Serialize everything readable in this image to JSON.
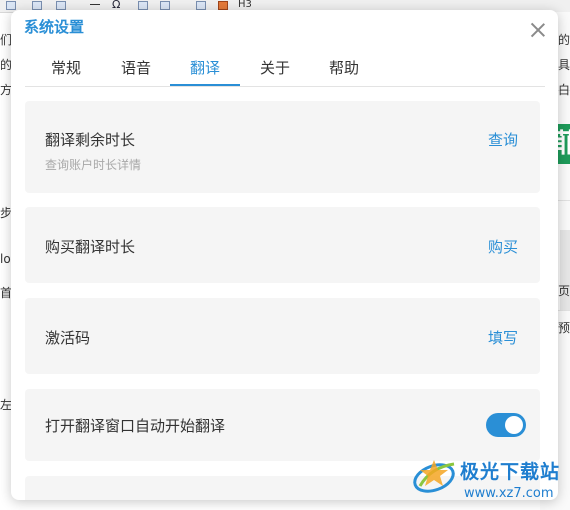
{
  "background_app": {
    "left_chars": [
      "们",
      "的",
      "方",
      "步",
      "lo",
      "首",
      "左"
    ],
    "right_chars": [
      "的",
      "具",
      "白",
      "页",
      "预"
    ],
    "green_char": "菲",
    "toolbar_glyphs": [
      "Ω",
      "H3"
    ]
  },
  "dialog": {
    "title": "系统设置",
    "close_icon": "close-icon",
    "tabs": [
      {
        "label": "常规",
        "active": false
      },
      {
        "label": "语音",
        "active": false
      },
      {
        "label": "翻译",
        "active": true
      },
      {
        "label": "关于",
        "active": false
      },
      {
        "label": "帮助",
        "active": false
      }
    ],
    "cards": [
      {
        "title": "翻译剩余时长",
        "subtitle": "查询账户时长详情",
        "action": "查询"
      },
      {
        "title": "购买翻译时长",
        "action": "购买"
      },
      {
        "title": "激活码",
        "action": "填写"
      },
      {
        "title": "打开翻译窗口自动开始翻译",
        "toggle_on": true
      }
    ]
  },
  "watermark": {
    "name": "极光下载站",
    "url": "www.xz7.com"
  },
  "colors": {
    "accent": "#2a8fd6",
    "card_bg": "#f5f5f5",
    "text": "#333333",
    "subtext": "#a8a8a8"
  }
}
